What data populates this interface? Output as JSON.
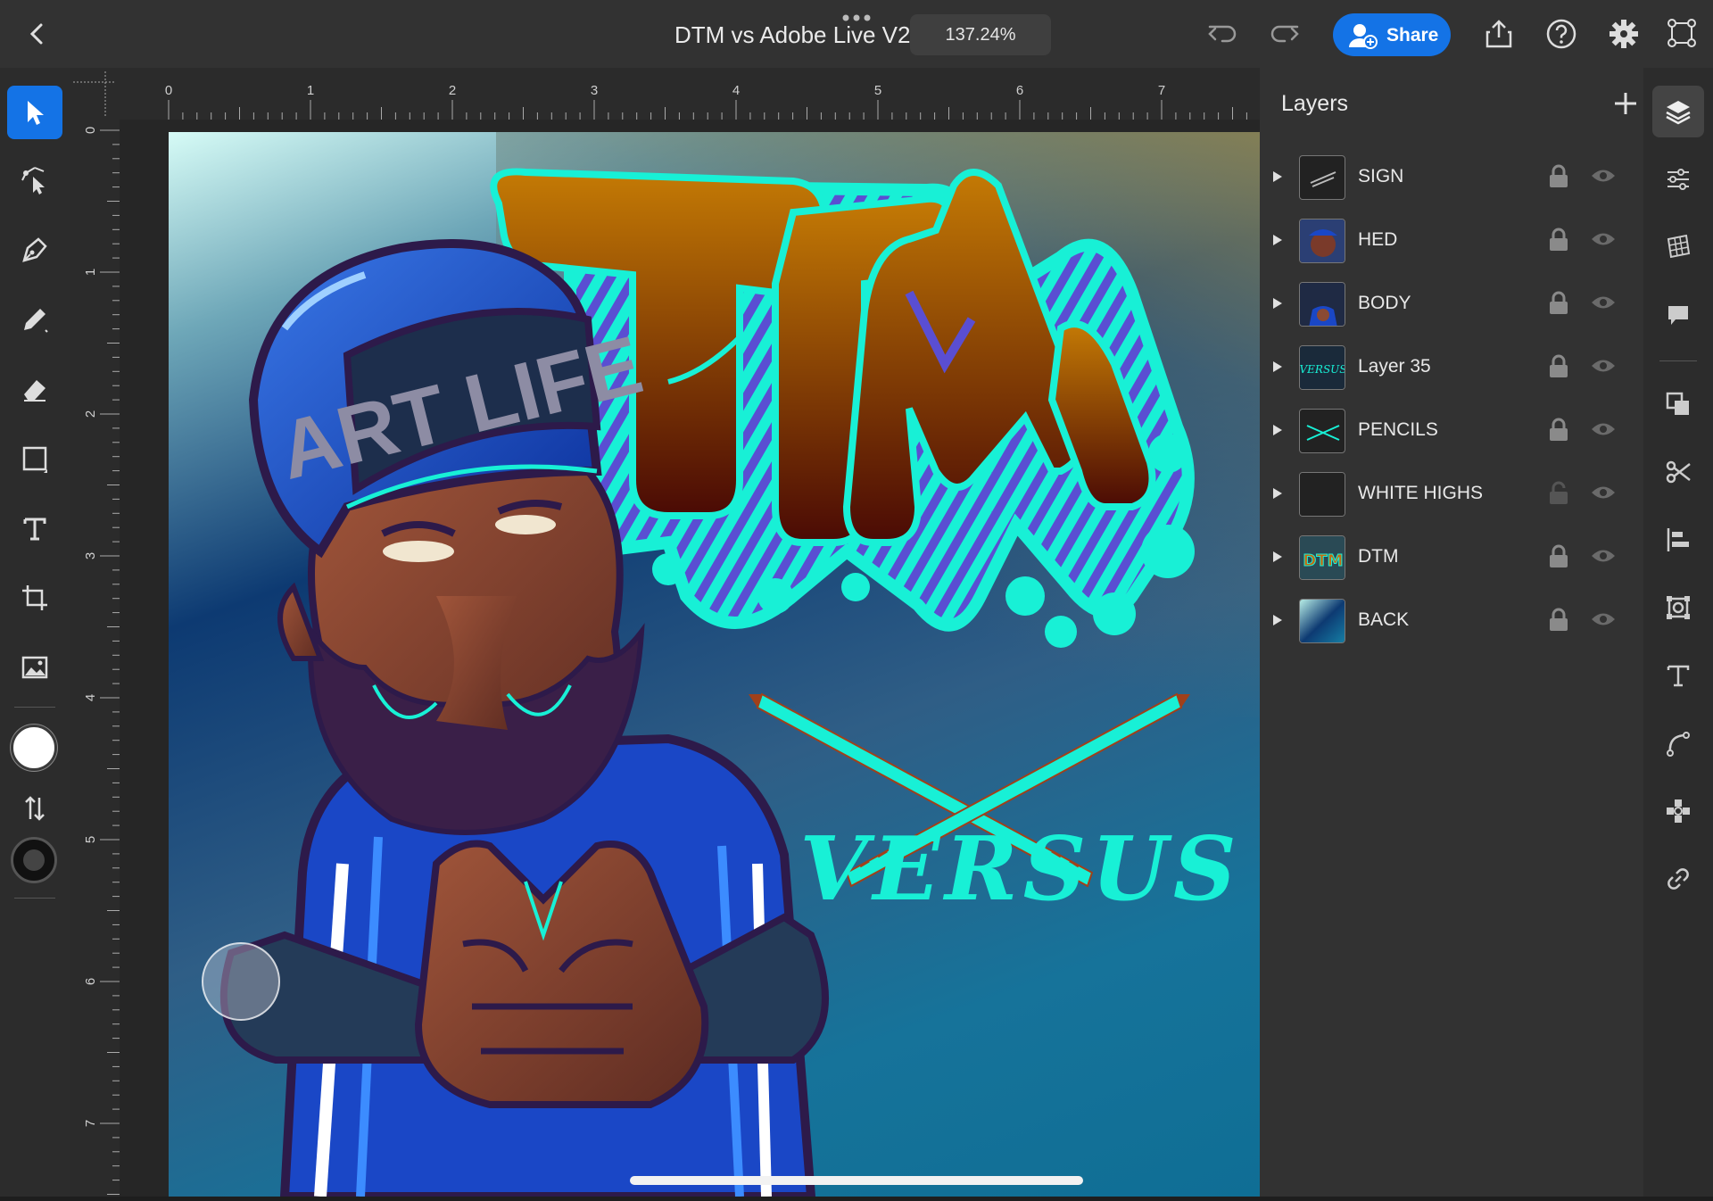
{
  "header": {
    "title": "DTM vs Adobe Live V2",
    "zoom": "137.24%",
    "share_label": "Share",
    "icons": [
      "chevron-left-icon",
      "more-dots-icon",
      "undo-icon",
      "redo-icon",
      "user-add-icon",
      "export-icon",
      "help-icon",
      "gear-icon",
      "transform-icon"
    ]
  },
  "ruler": {
    "h_labels": [
      "0",
      "1",
      "2",
      "3",
      "4",
      "5",
      "6",
      "7"
    ],
    "v_labels": [
      "0",
      "1",
      "2",
      "3",
      "4",
      "5",
      "6",
      "7"
    ]
  },
  "tools": [
    {
      "name": "select-tool",
      "icon": "arrow-icon",
      "active": true
    },
    {
      "name": "direct-select-tool",
      "icon": "node-select-icon"
    },
    {
      "name": "pen-tool",
      "icon": "pen-icon"
    },
    {
      "name": "pencil-tool",
      "icon": "pencil-icon"
    },
    {
      "name": "eraser-tool",
      "icon": "eraser-icon"
    },
    {
      "name": "rectangle-tool",
      "icon": "rectangle-icon"
    },
    {
      "name": "type-tool",
      "icon": "text-icon"
    },
    {
      "name": "crop-tool",
      "icon": "crop-icon"
    },
    {
      "name": "image-tool",
      "icon": "image-icon"
    }
  ],
  "artwork": {
    "cap_text": "ART LIFE",
    "logo_text": "DTM",
    "versus_text": "VERSUS",
    "colors": {
      "cyan": "#18f0d6",
      "brown": "#8a3a08",
      "blue": "#1448c4",
      "navy": "#0d2c66"
    }
  },
  "layers_panel": {
    "title": "Layers",
    "layers": [
      {
        "name": "SIGN",
        "locked": true
      },
      {
        "name": "HED",
        "locked": true
      },
      {
        "name": "BODY",
        "locked": true
      },
      {
        "name": "Layer 35",
        "locked": true
      },
      {
        "name": "PENCILS",
        "locked": true
      },
      {
        "name": "WHITE HIGHS",
        "locked": false
      },
      {
        "name": "DTM",
        "locked": true
      },
      {
        "name": "BACK",
        "locked": true
      }
    ]
  },
  "right_strip": {
    "icons": [
      "layers-icon",
      "sliders-icon",
      "grid-icon",
      "comment-icon",
      "arrange-icon",
      "scissors-icon",
      "align-icon",
      "transform-box-icon",
      "type-options-icon",
      "path-icon",
      "repeat-icon",
      "link-icon"
    ]
  }
}
